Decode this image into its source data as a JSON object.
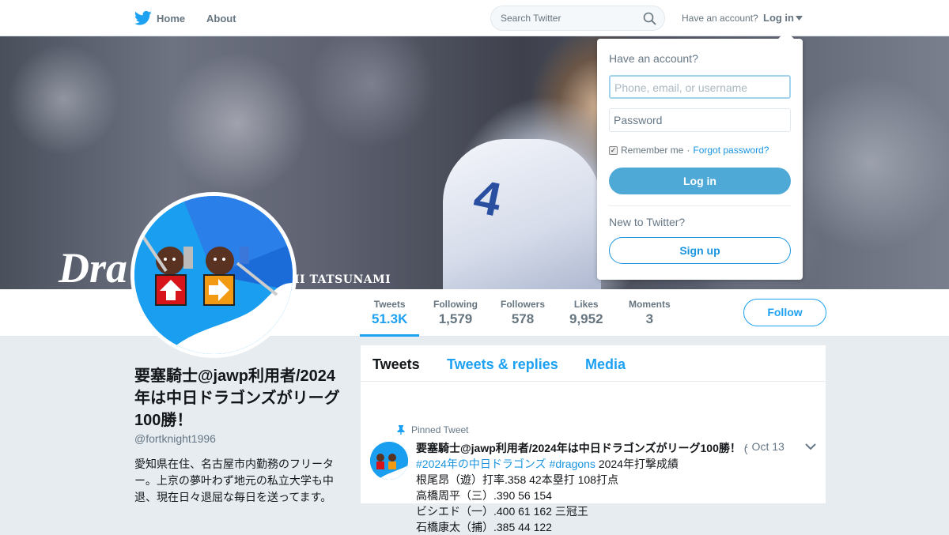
{
  "nav": {
    "home_label": "Home",
    "about_label": "About",
    "search_placeholder": "Search Twitter",
    "account_prompt": "Have an account?",
    "login_label": "Log in"
  },
  "banner": {
    "logo_text": "Dra",
    "caption": "II TATSUNAMI",
    "jersey_number": "4"
  },
  "stats": [
    {
      "label": "Tweets",
      "value": "51.3K",
      "active": true
    },
    {
      "label": "Following",
      "value": "1,579"
    },
    {
      "label": "Followers",
      "value": "578"
    },
    {
      "label": "Likes",
      "value": "9,952"
    },
    {
      "label": "Moments",
      "value": "3"
    }
  ],
  "follow_label": "Follow",
  "profile": {
    "name": "要塞騎士@jawp利用者/2024年は中日ドラゴンズがリーグ100勝！",
    "handle": "@fortknight1996",
    "bio": "愛知県在住、名古屋市内勤務のフリーター。上京の夢叶わず地元の私立大学も中退、現在日々退屈な毎日を送ってます。"
  },
  "timeline": {
    "tabs": [
      "Tweets",
      "Tweets & replies",
      "Media"
    ],
    "pinned_label": "Pinned Tweet",
    "tweet": {
      "author": "要塞騎士@jawp利用者/2024年は中日ドラゴンズがリーグ100勝！",
      "handle_stub": "(",
      "date": "· Oct 13",
      "hashtag1": "#2024年の中日ドラゴンズ",
      "hashtag2": "#dragons",
      "line1_rest": "2024年打撃成績",
      "lines": [
        "根尾昂（遊）打率.358 42本塁打 108打点",
        "高橋周平（三）.390 56 154",
        "ビシエド（一）.400 61 162 三冠王",
        "石橋康太（捕）.385 44 122"
      ]
    }
  },
  "login_dropdown": {
    "title": "Have an account?",
    "username_placeholder": "Phone, email, or username",
    "password_placeholder": "Password",
    "remember_label": "Remember me",
    "separator": "·",
    "forgot_label": "Forgot password?",
    "login_button": "Log in",
    "new_prompt": "New to Twitter?",
    "signup_button": "Sign up"
  },
  "colors": {
    "accent": "#1da1f2",
    "login_button": "#4fa9d7",
    "background": "#e6ecf0"
  },
  "icons": {
    "brand": "twitter-bird-icon",
    "search": "search-icon",
    "caret": "caret-down-icon",
    "pin": "pin-icon",
    "chevron": "chevron-down-icon"
  }
}
